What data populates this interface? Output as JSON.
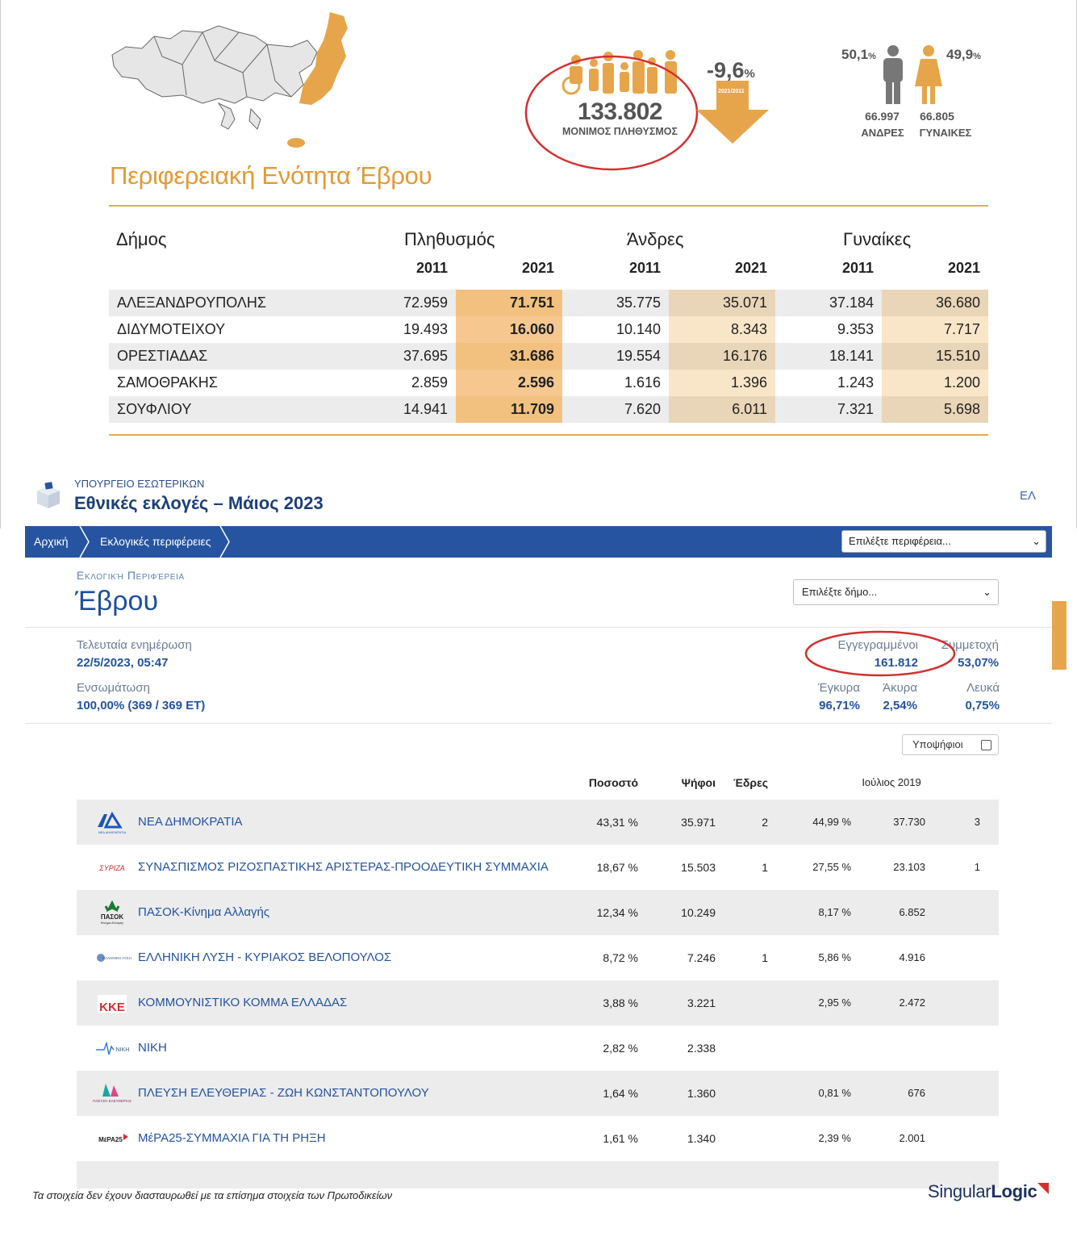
{
  "census": {
    "region_title": "Περιφερειακή Ενότητα Έβρου",
    "population": {
      "value": "133.802",
      "label": "ΜΟΝΙΜΟΣ ΠΛΗΘΥΣΜΟΣ"
    },
    "change": {
      "value": "-9,6",
      "unit": "%",
      "period": "2021/2011"
    },
    "men": {
      "pct": "50,1",
      "pct_unit": "%",
      "count": "66.997",
      "label": "ΑΝΔΡΕΣ"
    },
    "women": {
      "pct": "49,9",
      "pct_unit": "%",
      "count": "66.805",
      "label": "ΓΥΝΑΙΚΕΣ"
    },
    "table": {
      "col_municipality": "Δήμος",
      "col_population": "Πληθυσμός",
      "col_men": "Άνδρες",
      "col_women": "Γυναίκες",
      "years": [
        "2011",
        "2021",
        "2011",
        "2021",
        "2011",
        "2021"
      ],
      "rows": [
        {
          "name": "ΑΛΕΞΑΝΔΡΟΥΠΟΛΗΣ",
          "p2011": "72.959",
          "p2021": "71.751",
          "m2011": "35.775",
          "m2021": "35.071",
          "w2011": "37.184",
          "w2021": "36.680"
        },
        {
          "name": "ΔΙΔΥΜΟΤΕΙΧΟΥ",
          "p2011": "19.493",
          "p2021": "16.060",
          "m2011": "10.140",
          "m2021": "8.343",
          "w2011": "9.353",
          "w2021": "7.717"
        },
        {
          "name": "ΟΡΕΣΤΙΑΔΑΣ",
          "p2011": "37.695",
          "p2021": "31.686",
          "m2011": "19.554",
          "m2021": "16.176",
          "w2011": "18.141",
          "w2021": "15.510"
        },
        {
          "name": "ΣΑΜΟΘΡΑΚΗΣ",
          "p2011": "2.859",
          "p2021": "2.596",
          "m2011": "1.616",
          "m2021": "1.396",
          "w2011": "1.243",
          "w2021": "1.200"
        },
        {
          "name": "ΣΟΥΦΛΙΟΥ",
          "p2011": "14.941",
          "p2021": "11.709",
          "m2011": "7.620",
          "m2021": "6.011",
          "w2011": "7.321",
          "w2021": "5.698"
        }
      ]
    },
    "colors": {
      "accent": "#e9a94b",
      "highlight": "#f6c88f",
      "annotation": "#d32f2f"
    }
  },
  "site": {
    "ministry": "ΥΠΟΥΡΓΕΙΟ ΕΣΩΤΕΡΙΚΩΝ",
    "title": "Εθνικές εκλογές – Μάιος 2023",
    "language": "ΕΛ",
    "nav": {
      "home": "Αρχική",
      "regions": "Εκλογικές περιφέρειες",
      "region_select": "Επιλέξτε περιφέρεια..."
    },
    "region_kicker": "Εκλογική Περιφέρεια",
    "region_name": "Έβρου",
    "municipality_select": "Επιλέξτε δήμο...",
    "stats": {
      "last_update_label": "Τελευταία ενημέρωση",
      "last_update_value": "22/5/2023, 05:47",
      "incorporation_label": "Ενσωμάτωση",
      "incorporation_value": "100,00% (369 / 369 ΕΤ)",
      "registered_label": "Εγγεγραμμένοι",
      "registered_value": "161.812",
      "turnout_label": "Συμμετοχή",
      "turnout_value": "53,07%",
      "valid_label": "Έγκυρα",
      "valid_value": "96,71%",
      "invalid_label": "Άκυρα",
      "invalid_value": "2,54%",
      "blank_label": "Λευκά",
      "blank_value": "0,75%"
    },
    "candidates_toggle": "Υποψήφιοι",
    "columns": {
      "pct": "Ποσοστό",
      "votes": "Ψήφοι",
      "seats": "Έδρες",
      "previous": "Ιούλιος 2019"
    },
    "parties": [
      {
        "name": "ΝΕΑ ΔΗΜΟΚΡΑΤΙΑ",
        "pct": "43,31 %",
        "votes": "35.971",
        "seats": "2",
        "prev_pct": "44,99 %",
        "prev_votes": "37.730",
        "prev_seats": "3"
      },
      {
        "name": "ΣΥΝΑΣΠΙΣΜΟΣ ΡΙΖΟΣΠΑΣΤΙΚΗΣ ΑΡΙΣΤΕΡΑΣ-ΠΡΟΟΔΕΥΤΙΚΗ ΣΥΜΜΑΧΙΑ",
        "pct": "18,67 %",
        "votes": "15.503",
        "seats": "1",
        "prev_pct": "27,55 %",
        "prev_votes": "23.103",
        "prev_seats": "1"
      },
      {
        "name": "ΠΑΣΟΚ-Κίνημα Αλλαγής",
        "pct": "12,34 %",
        "votes": "10.249",
        "seats": "",
        "prev_pct": "8,17 %",
        "prev_votes": "6.852",
        "prev_seats": ""
      },
      {
        "name": "ΕΛΛΗΝΙΚΗ ΛΥΣΗ - ΚΥΡΙΑΚΟΣ ΒΕΛΟΠΟΥΛΟΣ",
        "pct": "8,72 %",
        "votes": "7.246",
        "seats": "1",
        "prev_pct": "5,86 %",
        "prev_votes": "4.916",
        "prev_seats": ""
      },
      {
        "name": "ΚΟΜΜΟΥΝΙΣΤΙΚΟ ΚΟΜΜΑ ΕΛΛΑΔΑΣ",
        "pct": "3,88 %",
        "votes": "3.221",
        "seats": "",
        "prev_pct": "2,95 %",
        "prev_votes": "2.472",
        "prev_seats": ""
      },
      {
        "name": "ΝΙΚΗ",
        "pct": "2,82 %",
        "votes": "2.338",
        "seats": "",
        "prev_pct": "",
        "prev_votes": "",
        "prev_seats": ""
      },
      {
        "name": "ΠΛΕΥΣΗ ΕΛΕΥΘΕΡΙΑΣ - ΖΩΗ ΚΩΝΣΤΑΝΤΟΠΟΥΛΟΥ",
        "pct": "1,64 %",
        "votes": "1.360",
        "seats": "",
        "prev_pct": "0,81 %",
        "prev_votes": "676",
        "prev_seats": ""
      },
      {
        "name": "ΜέΡΑ25-ΣΥΜΜΑΧΙΑ ΓΙΑ ΤΗ ΡΗΞΗ",
        "pct": "1,61 %",
        "votes": "1.340",
        "seats": "",
        "prev_pct": "2,39 %",
        "prev_votes": "2.001",
        "prev_seats": ""
      }
    ],
    "party_logos": {
      "nd": "ΝΔ",
      "nd_sub": "ΝΕΑ ΔΗΜΟΚΡΑΤΙΑ",
      "syriza": "ΣΥΡΙΖΑ",
      "pasok": "ΠΑΣΟΚ",
      "pasok_sub": "Κίνημα Αλλαγής",
      "ellisi": "ΕΛΛΗΝΙΚΗ ΛΥΣΗ",
      "kke": "ΚΚΕ",
      "niki": "ΝΙΚΗ",
      "plefsi": "ΠΛΕΥΣΗ ΕΛΕΥΘΕΡΙΑΣ",
      "mera25": "ΜέΡΑ25"
    },
    "footnote": "Τα στοιχεία δεν έχουν διασταυρωθεί με τα επίσημα στοιχεία των Πρωτοδικείων",
    "brand": {
      "part1": "Singular",
      "part2": "Logic"
    },
    "colors": {
      "nav": "#2654a0",
      "link": "#2352a0",
      "row_shade": "#ececec"
    }
  }
}
